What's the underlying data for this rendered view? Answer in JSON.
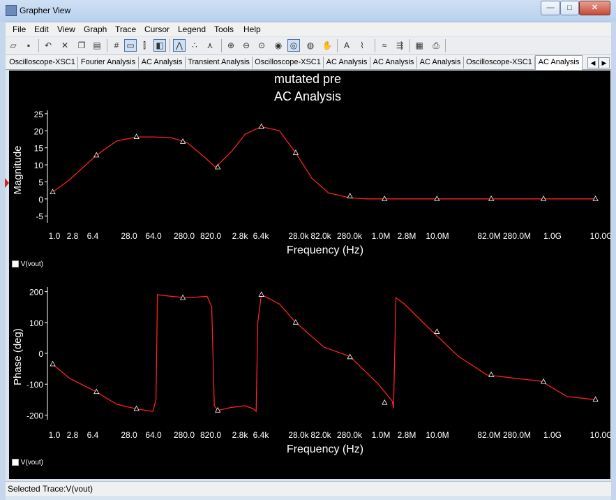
{
  "window": {
    "title": "Grapher View"
  },
  "menubar": {
    "items": [
      "File",
      "Edit",
      "View",
      "Graph",
      "Trace",
      "Cursor",
      "Legend",
      "Tools",
      "Help"
    ]
  },
  "toolbar": {
    "buttons": [
      {
        "icon": "open-folder-icon",
        "glyph": "▱"
      },
      {
        "icon": "save-icon",
        "glyph": "▪"
      },
      {
        "icon": "undo-icon",
        "glyph": "↶"
      },
      {
        "icon": "delete-icon",
        "glyph": "✕"
      },
      {
        "icon": "copy-icon",
        "glyph": "❐"
      },
      {
        "icon": "paste-icon",
        "glyph": "▤"
      },
      {
        "icon": "grid-icon",
        "glyph": "#"
      },
      {
        "icon": "show-legend-icon",
        "glyph": "▭"
      },
      {
        "icon": "cursors-icon",
        "glyph": "⫿"
      },
      {
        "icon": "reverse-colors-icon",
        "glyph": "◧"
      },
      {
        "icon": "line-plot-icon",
        "glyph": "⋀"
      },
      {
        "icon": "points-plot-icon",
        "glyph": "∴"
      },
      {
        "icon": "lines-points-icon",
        "glyph": "⋏"
      },
      {
        "icon": "zoom-in-icon",
        "glyph": "⊕"
      },
      {
        "icon": "zoom-out-icon",
        "glyph": "⊖"
      },
      {
        "icon": "zoom-area-icon",
        "glyph": "⊙"
      },
      {
        "icon": "zoom-fit-icon",
        "glyph": "◉"
      },
      {
        "icon": "zoom-x-icon",
        "glyph": "◎"
      },
      {
        "icon": "zoom-y-icon",
        "glyph": "◍"
      },
      {
        "icon": "pan-hand-icon",
        "glyph": "✋"
      },
      {
        "icon": "text-icon",
        "glyph": "A"
      },
      {
        "icon": "label-icon",
        "glyph": "⌇"
      },
      {
        "icon": "overlay-traces-icon",
        "glyph": "≈"
      },
      {
        "icon": "export-icon",
        "glyph": "⇶"
      },
      {
        "icon": "properties-icon",
        "glyph": "▦"
      },
      {
        "icon": "print-icon",
        "glyph": "⎙"
      }
    ]
  },
  "tabs": [
    "Oscilloscope-XSC1",
    "Fourier Analysis",
    "AC Analysis",
    "Transient Analysis",
    "Oscilloscope-XSC1",
    "AC Analysis",
    "AC Analysis",
    "AC Analysis",
    "Oscilloscope-XSC1",
    "AC Analysis"
  ],
  "active_tab": 9,
  "status": {
    "text": "Selected Trace:V(vout)"
  },
  "chart_data": [
    {
      "type": "line",
      "title": "mutated pre",
      "subtitle": "AC Analysis",
      "xlabel": "Frequency (Hz)",
      "ylabel": "Magnitude",
      "xscale": "log",
      "xlim": [
        0.8,
        14000000000
      ],
      "ylim": [
        -7,
        26
      ],
      "yticks": [
        "25",
        "20",
        "15",
        "10",
        "5",
        "0",
        "-5"
      ],
      "xticks": [
        "1.0",
        "2.8",
        "6.4",
        "28.0",
        "64.0",
        "280.0",
        "820.0",
        "2.8k",
        "6.4k",
        "28.0k",
        "82.0k",
        "280.0k",
        "1.0M",
        "2.8M",
        "10.0M",
        "82.0M",
        "280.0M",
        "1.0G",
        "10.0G"
      ],
      "grid": false,
      "series": [
        {
          "name": "V(vout)",
          "color": "#ff2020",
          "x": [
            1,
            2,
            6.4,
            15,
            35,
            70,
            150,
            300,
            600,
            1000,
            2000,
            3500,
            7000,
            15000,
            30000,
            60000,
            120000,
            300000,
            600000,
            1000000,
            3000000,
            10000000,
            100000000,
            1000000000,
            10000000000
          ],
          "y": [
            2.0,
            5.5,
            12.8,
            17.0,
            18.2,
            18.2,
            18.0,
            16.5,
            12.5,
            9.3,
            14.0,
            19.0,
            21.2,
            20.0,
            13.5,
            6.0,
            1.8,
            0.3,
            0.0,
            0.0,
            0.0,
            0.0,
            0.0,
            0.0,
            0.0
          ]
        }
      ],
      "markers": {
        "x": [
          1,
          6.4,
          35,
          250,
          1100,
          7000,
          30000,
          300000,
          1300000,
          12000000,
          120000000,
          1100000000,
          10000000000
        ],
        "y": [
          2.0,
          12.8,
          18.2,
          16.8,
          9.3,
          21.2,
          13.5,
          0.8,
          0.0,
          0.0,
          0.0,
          0.0,
          0.0
        ]
      }
    },
    {
      "type": "line",
      "xlabel": "Frequency (Hz)",
      "ylabel": "Phase (deg)",
      "xscale": "log",
      "xlim": [
        0.8,
        14000000000
      ],
      "ylim": [
        -215,
        215
      ],
      "yticks": [
        "200",
        "100",
        "0",
        "-100",
        "-200"
      ],
      "xticks": [
        "1.0",
        "2.8",
        "6.4",
        "28.0",
        "64.0",
        "280.0",
        "820.0",
        "2.8k",
        "6.4k",
        "28.0k",
        "82.0k",
        "280.0k",
        "1.0M",
        "2.8M",
        "10.0M",
        "82.0M",
        "280.0M",
        "1.0G",
        "10.0G"
      ],
      "grid": false,
      "series": [
        {
          "name": "V(vout)",
          "color": "#ff2020",
          "x": [
            1,
            2,
            6.4,
            15,
            35,
            70,
            80,
            85,
            150,
            300,
            700,
            850,
            950,
            1100,
            2000,
            3500,
            5000,
            5600,
            6000,
            7000,
            15000,
            30000,
            100000,
            300000,
            1000000,
            1800000,
            1900000,
            2100000,
            3000000,
            10000000,
            30000000,
            100000000,
            300000000,
            1000000000,
            3000000000,
            10000000000
          ],
          "y": [
            -35,
            -80,
            -125,
            -165,
            -180,
            -188,
            -150,
            190,
            185,
            180,
            185,
            150,
            -170,
            -185,
            -175,
            -170,
            -180,
            -188,
            100,
            190,
            160,
            100,
            20,
            -10,
            -100,
            -155,
            -178,
            180,
            160,
            70,
            -10,
            -70,
            -80,
            -90,
            -140,
            -150
          ]
        }
      ],
      "markers": {
        "x": [
          1,
          6.4,
          35,
          250,
          1100,
          7000,
          30000,
          300000,
          1300000,
          12000000,
          120000000,
          1100000000,
          10000000000
        ],
        "y": [
          -35,
          -125,
          -180,
          180,
          -185,
          190,
          100,
          -12,
          -160,
          70,
          -70,
          -92,
          -150
        ]
      }
    }
  ]
}
